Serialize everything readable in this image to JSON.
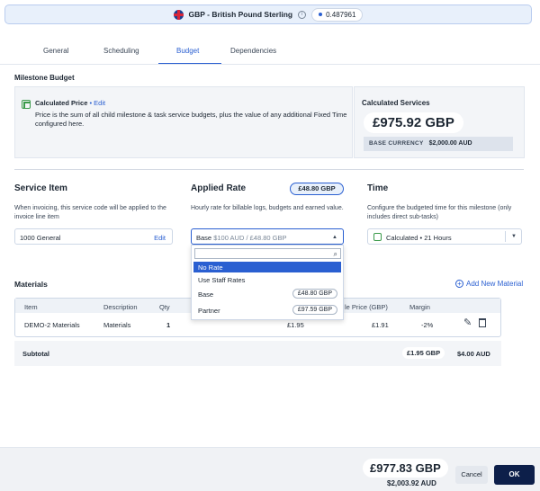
{
  "currency_bar": {
    "label": "GBP - British Pound Sterling",
    "info_icon": "info-icon",
    "rate": "0.487961"
  },
  "tabs": [
    {
      "label": "General"
    },
    {
      "label": "Scheduling"
    },
    {
      "label": "Budget"
    },
    {
      "label": "Dependencies"
    }
  ],
  "milestone_budget": {
    "title": "Milestone Budget",
    "calc_title": "Calculated Price",
    "calc_sep": " • ",
    "calc_edit": "Edit",
    "calc_desc": "Price is the sum of all child milestone & task service budgets, plus the value of any additional Fixed Time configured here.",
    "services_title": "Calculated Services",
    "services_total": "£975.92 GBP",
    "base_label": "BASE CURRENCY",
    "base_value": "$2,000.00 AUD"
  },
  "service_item": {
    "title": "Service Item",
    "desc": "When invoicing, this service code will be applied to the invoice line item",
    "value": "1000 General",
    "edit": "Edit"
  },
  "applied_rate": {
    "title": "Applied Rate",
    "pill": "£48.80 GBP",
    "desc": "Hourly rate for billable logs, budgets and earned value.",
    "select_main": "Base",
    "select_muted": " $100 AUD / £48.80 GBP",
    "dropdown": {
      "items": [
        {
          "label": "No Rate",
          "pill": ""
        },
        {
          "label": "Use Staff Rates",
          "pill": ""
        },
        {
          "label": "Base",
          "pill": "£48.80 GBP"
        },
        {
          "label": "Partner",
          "pill": "£97.59 GBP"
        }
      ]
    }
  },
  "time": {
    "title": "Time",
    "desc": "Configure the budgeted time for this milestone (only includes direct sub-tasks)",
    "value": "Calculated • 21 Hours"
  },
  "materials": {
    "title": "Materials",
    "add_label": "Add New Material",
    "headers": [
      "Item",
      "Description",
      "Qty",
      "le Price (GBP)",
      "Margin"
    ],
    "row": {
      "item": "DEMO-2 Materials",
      "description": "Materials",
      "qty": "1",
      "unit_cost": "£1.95",
      "sale_price": "£1.91",
      "margin": "-2%"
    },
    "subtotal_label": "Subtotal",
    "subtotal_gbp": "£1.95 GBP",
    "subtotal_aud": "$4.00 AUD"
  },
  "footer": {
    "total": "£977.83 GBP",
    "base": "$2,003.92 AUD",
    "cancel": "Cancel",
    "ok": "OK"
  },
  "colors": {
    "accent": "#2a5fd1",
    "ok_button": "#0d1f4a",
    "calc_icon": "#3a9a4a"
  }
}
